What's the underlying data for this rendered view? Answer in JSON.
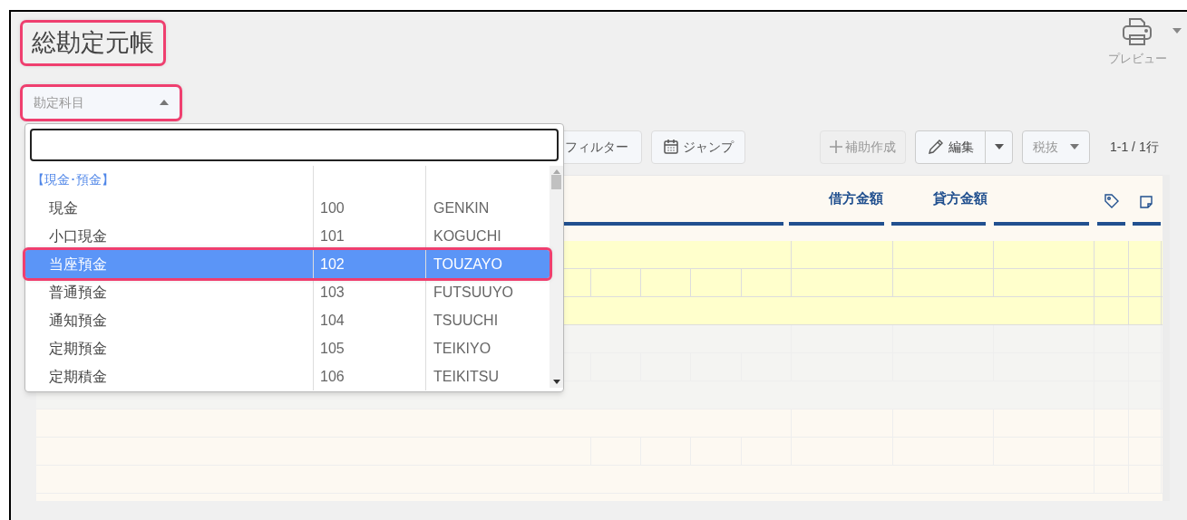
{
  "title": {
    "text": "総勘定元帳",
    "highlighted": true
  },
  "preview": {
    "label": "プレビュー"
  },
  "account_select": {
    "placeholder": "勘定科目",
    "highlighted": true,
    "expanded": true
  },
  "dropdown": {
    "items": [
      {
        "kind": "group",
        "name": "【現金･預金】"
      },
      {
        "kind": "item",
        "name": "現金",
        "code": "100",
        "kana": "GENKIN",
        "selected": false,
        "highlighted": false
      },
      {
        "kind": "item",
        "name": "小口現金",
        "code": "101",
        "kana": "KOGUCHI",
        "selected": false,
        "highlighted": false
      },
      {
        "kind": "item",
        "name": "当座預金",
        "code": "102",
        "kana": "TOUZAYO",
        "selected": true,
        "highlighted": true
      },
      {
        "kind": "item",
        "name": "普通預金",
        "code": "103",
        "kana": "FUTSUUYO",
        "selected": false,
        "highlighted": false
      },
      {
        "kind": "item",
        "name": "通知預金",
        "code": "104",
        "kana": "TSUUCHI",
        "selected": false,
        "highlighted": false
      },
      {
        "kind": "item",
        "name": "定期預金",
        "code": "105",
        "kana": "TEIKIYO",
        "selected": false,
        "highlighted": false
      },
      {
        "kind": "item",
        "name": "定期積金",
        "code": "106",
        "kana": "TEIKITSU",
        "selected": false,
        "highlighted": false
      }
    ]
  },
  "toolbar": {
    "filter": "フィルター",
    "jump": "ジャンプ",
    "add_sub": {
      "label": "補助作成",
      "disabled": true
    },
    "edit": "編集",
    "tax": "税抜",
    "pagination": "1-1 / 1行"
  },
  "table": {
    "columns": [
      "借方金額",
      "貸方金額"
    ],
    "records": [
      {
        "selected": true
      },
      {
        "selected": false
      },
      {
        "selected": false
      }
    ]
  }
}
